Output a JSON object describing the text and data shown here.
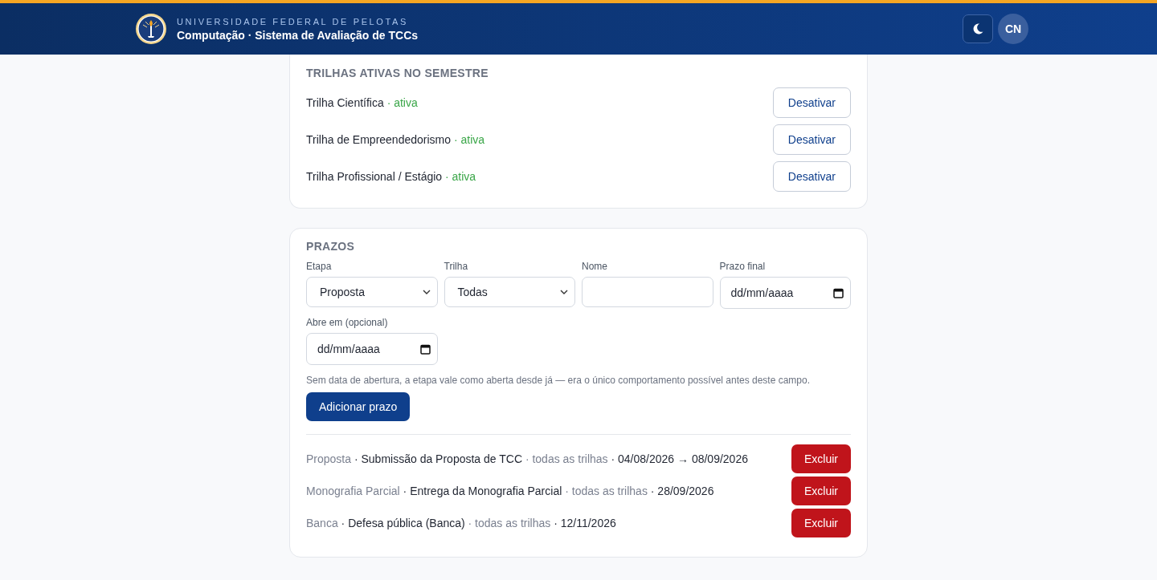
{
  "header": {
    "institution": "UNIVERSIDADE FEDERAL DE PELOTAS",
    "title": "Computação · Sistema de Avaliação de TCCs",
    "avatar": "CN"
  },
  "tracks_card": {
    "title": "TRILHAS ATIVAS NO SEMESTRE",
    "tracks": [
      {
        "name": "Trilha Científica",
        "status": "· ativa",
        "active": true,
        "action": "Desativar"
      },
      {
        "name": "Trilha de Empreendedorismo",
        "status": "· ativa",
        "active": true,
        "action": "Desativar"
      },
      {
        "name": "Trilha Profissional / Estágio",
        "status": "· ativa",
        "active": true,
        "action": "Desativar"
      }
    ]
  },
  "deadlines_card": {
    "title": "PRAZOS",
    "fields": [
      {
        "label": "Etapa",
        "kind": "select",
        "value": "Proposta"
      },
      {
        "label": "Trilha",
        "kind": "select",
        "value": "Todas"
      },
      {
        "label": "Nome",
        "kind": "text"
      },
      {
        "label": "Prazo final",
        "kind": "date",
        "value": "dd/mm/aaaa"
      },
      {
        "label": "Abre em (opcional)",
        "kind": "date",
        "value": "dd/mm/aaaa"
      }
    ],
    "hint": "Sem data de abertura, a etapa vale como aberta desde já — era o único comportamento possível antes deste campo.",
    "add_button": "Adicionar prazo",
    "deadlines": [
      {
        "parts": [
          {
            "text": "Proposta",
            "muted": true
          },
          {
            "text": " · Submissão da Proposta de TCC",
            "muted": false
          },
          {
            "text": " · todas as trilhas",
            "muted": true
          },
          {
            "text": " · 04/08/2026 → 08/09/2026",
            "muted": false
          }
        ],
        "action": "Excluir"
      },
      {
        "parts": [
          {
            "text": "Monografia Parcial",
            "muted": true
          },
          {
            "text": " · Entrega da Monografia Parcial",
            "muted": false
          },
          {
            "text": " · todas as trilhas",
            "muted": true
          },
          {
            "text": " · 28/09/2026",
            "muted": false
          }
        ],
        "action": "Excluir"
      },
      {
        "parts": [
          {
            "text": "Banca",
            "muted": true
          },
          {
            "text": " · Defesa pública (Banca)",
            "muted": false
          },
          {
            "text": " · todas as trilhas",
            "muted": true
          },
          {
            "text": " · 12/11/2026",
            "muted": false
          }
        ],
        "action": "Excluir"
      }
    ]
  }
}
